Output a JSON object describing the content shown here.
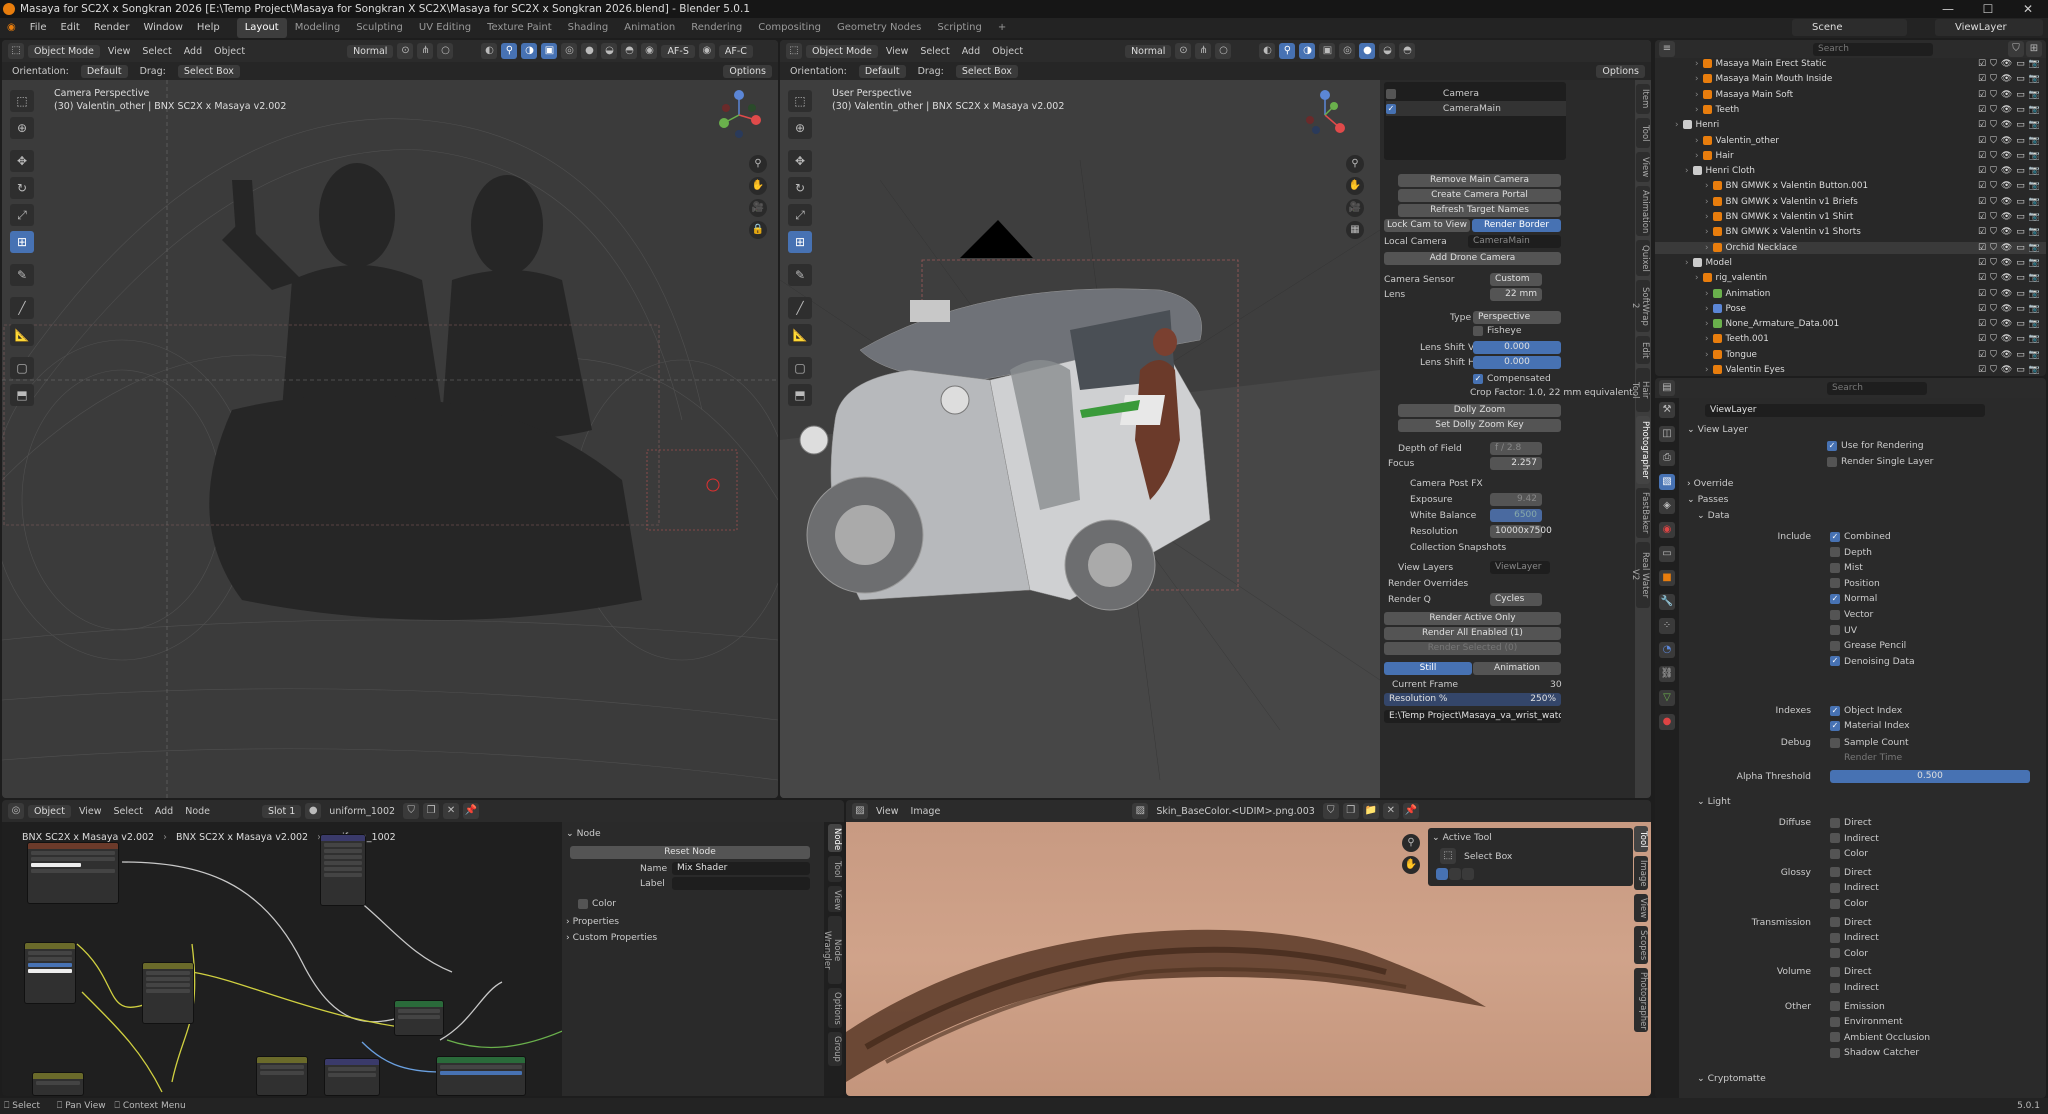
{
  "window": {
    "title": "Masaya for SC2X x Songkran 2026 [E:\\Temp Project\\Masaya for Songkran X SC2X\\Masaya for SC2X x Songkran 2026.blend] - Blender 5.0.1",
    "min": "—",
    "max": "☐",
    "close": "✕"
  },
  "menu": [
    "File",
    "Edit",
    "Render",
    "Window",
    "Help"
  ],
  "workspaces": [
    "Layout",
    "Modeling",
    "Sculpting",
    "UV Editing",
    "Texture Paint",
    "Shading",
    "Animation",
    "Rendering",
    "Compositing",
    "Geometry Nodes",
    "Scripting",
    "+"
  ],
  "scene": "Scene",
  "view_layer": "ViewLayer",
  "left_viewport": {
    "mode": "Object Mode",
    "menus": [
      "View",
      "Select",
      "Add",
      "Object"
    ],
    "shading": "Normal",
    "af_s": "AF-S",
    "af_c": "AF-C",
    "orientation_label": "Orientation:",
    "orientation": "Default",
    "drag_label": "Drag:",
    "drag": "Select Box",
    "options": "Options",
    "view_name": "Camera Perspective",
    "object_info": "(30) Valentin_other | BNX SC2X x Masaya v2.002"
  },
  "right_viewport": {
    "mode": "Object Mode",
    "menus": [
      "View",
      "Select",
      "Add",
      "Object"
    ],
    "shading": "Normal",
    "orientation_label": "Orientation:",
    "orientation": "Default",
    "drag_label": "Drag:",
    "drag": "Select Box",
    "options": "Options",
    "view_name": "User Perspective",
    "object_info": "(30) Valentin_other | BNX SC2X x Masaya v2.002"
  },
  "photographer": {
    "cameras": [
      "Camera",
      "CameraMain"
    ],
    "remove_main_camera": "Remove Main Camera",
    "create_camera_portal": "Create Camera Portal",
    "refresh_target_names": "Refresh Target Names",
    "lock_cam_to_view": "Lock Cam to View",
    "render_border": "Render Border",
    "local_camera_label": "Local Camera",
    "local_camera_value": "CameraMain",
    "add_drone_camera": "Add Drone Camera",
    "camera_sensor_label": "Camera Sensor",
    "camera_sensor_value": "Custom",
    "lens_label": "Lens",
    "lens_value": "22 mm",
    "type_label": "Type",
    "type_value": "Perspective",
    "fisheye": "Fisheye",
    "lens_shift_v_label": "Lens Shift V",
    "lens_shift_v": "0.000",
    "lens_shift_h_label": "Lens Shift H",
    "lens_shift_h": "0.000",
    "compensated": "Compensated",
    "crop_factor": "Crop Factor: 1.0, 22 mm equivalent.",
    "dolly_zoom": "Dolly Zoom",
    "set_dolly_zoom_key": "Set Dolly Zoom Key",
    "depth_of_field_label": "Depth of Field",
    "depth_of_field_value": "f / 2.8",
    "focus_label": "Focus",
    "focus_value": "2.257",
    "camera_post_fx": "Camera Post FX",
    "exposure_label": "Exposure",
    "exposure_value": "9.42",
    "white_balance_label": "White Balance",
    "white_balance_value": "6500",
    "resolution_label": "Resolution",
    "resolution_value": "10000x7500",
    "collection_snapshots": "Collection Snapshots",
    "view_layers_label": "View Layers",
    "view_layers_value": "ViewLayer",
    "render_overrides": "Render Overrides",
    "render_q_label": "Render Q",
    "render_q_engine": "Cycles",
    "render_active_only": "Render Active Only",
    "render_all_enabled": "Render All Enabled (1)",
    "render_selected": "Render Selected (0)",
    "still": "Still",
    "animation": "Animation",
    "current_frame_label": "Current Frame",
    "current_frame_value": "30",
    "resolution_pct_label": "Resolution %",
    "resolution_pct_value": "250%",
    "output_path": "E:\\Temp Project\\Masaya_va_wrist_watch_shadow"
  },
  "n_tabs_right": [
    "Item",
    "Tool",
    "View",
    "Animation",
    "Quixel",
    "SoftWrap 2",
    "Edit",
    "Hair Tool",
    "Photographer",
    "FastBaker",
    "Real Water V2"
  ],
  "outliner": {
    "search_placeholder": "Search",
    "items": [
      {
        "label": "Masaya Main Erect Static",
        "indent": 4
      },
      {
        "label": "Masaya Main Mouth Inside",
        "indent": 4
      },
      {
        "label": "Masaya Main Soft",
        "indent": 4
      },
      {
        "label": "Teeth",
        "indent": 4
      },
      {
        "label": "Henri",
        "indent": 2
      },
      {
        "label": "Valentin_other",
        "indent": 4
      },
      {
        "label": "Hair",
        "indent": 4
      },
      {
        "label": "Henri Cloth",
        "indent": 3
      },
      {
        "label": "BN GMWK x Valentin Button.001",
        "indent": 5
      },
      {
        "label": "BN GMWK x Valentin v1 Briefs",
        "indent": 5
      },
      {
        "label": "BN GMWK x Valentin v1 Shirt",
        "indent": 5
      },
      {
        "label": "BN GMWK x Valentin v1 Shorts",
        "indent": 5
      },
      {
        "label": "Orchid Necklace",
        "indent": 5
      },
      {
        "label": "Model",
        "indent": 3
      },
      {
        "label": "rig_valentin",
        "indent": 4
      },
      {
        "label": "Animation",
        "indent": 5
      },
      {
        "label": "Pose",
        "indent": 5
      },
      {
        "label": "None_Armature_Data.001",
        "indent": 5
      },
      {
        "label": "Teeth.001",
        "indent": 5
      },
      {
        "label": "Tongue",
        "indent": 5
      },
      {
        "label": "Valentin Eyes",
        "indent": 5
      }
    ],
    "badges": {
      "valentin_other": "2",
      "armature": "16"
    }
  },
  "properties": {
    "search_placeholder": "Search",
    "view_layer_name": "ViewLayer",
    "view_layer_panel": "View Layer",
    "use_for_rendering": "Use for Rendering",
    "render_single_layer": "Render Single Layer",
    "override": "Override",
    "passes": "Passes",
    "data": "Data",
    "include_label": "Include",
    "include": [
      {
        "label": "Combined",
        "on": true
      },
      {
        "label": "Depth",
        "on": false
      },
      {
        "label": "Mist",
        "on": false
      },
      {
        "label": "Position",
        "on": false
      },
      {
        "label": "Normal",
        "on": true
      },
      {
        "label": "Vector",
        "on": false
      },
      {
        "label": "UV",
        "on": false
      },
      {
        "label": "Grease Pencil",
        "on": false
      },
      {
        "label": "Denoising Data",
        "on": true
      }
    ],
    "indexes_label": "Indexes",
    "object_index": "Object Index",
    "material_index": "Material Index",
    "debug_label": "Debug",
    "sample_count": "Sample Count",
    "render_time": "Render Time",
    "alpha_threshold_label": "Alpha Threshold",
    "alpha_threshold_value": "0.500",
    "light": "Light",
    "diffuse_label": "Diffuse",
    "glossy_label": "Glossy",
    "transmission_label": "Transmission",
    "volume_label": "Volume",
    "other_label": "Other",
    "direct": "Direct",
    "indirect": "Indirect",
    "color": "Color",
    "emission": "Emission",
    "environment": "Environment",
    "ambient_occlusion": "Ambient Occlusion",
    "shadow_catcher": "Shadow Catcher",
    "cryptomatte": "Cryptomatte"
  },
  "node_editor": {
    "mode": "Object",
    "menus": [
      "View",
      "Select",
      "Add",
      "Node"
    ],
    "slot": "Slot 1",
    "material": "uniform_1002",
    "breadcrumb_obj": "BNX SC2X x Masaya v2.002",
    "breadcrumb_mesh": "BNX SC2X x Masaya v2.002",
    "breadcrumb_mat": "uniform_1002",
    "panel_title": "Node",
    "reset_node": "Reset Node",
    "name_label": "Name",
    "name_value": "Mix Shader",
    "label_label": "Label",
    "color": "Color",
    "properties": "Properties",
    "custom_properties": "Custom Properties",
    "tabs": [
      "Node",
      "Tool",
      "View",
      "Node Wrangler",
      "Options",
      "Group"
    ]
  },
  "image_editor": {
    "menus": [
      "View",
      "Image"
    ],
    "image_name": "Skin_BaseColor.<UDIM>.png.003",
    "active_tool": "Active Tool",
    "select_box": "Select Box",
    "tabs": [
      "Tool",
      "Image",
      "View",
      "Scopes",
      "Photographer"
    ]
  },
  "statusbar": {
    "select": "Select",
    "pan_view": "Pan View",
    "context_menu": "Context Menu",
    "version": "5.0.1"
  },
  "colors": {
    "accent": "#4772b3",
    "header": "#2b2b2b",
    "panel": "#2a2a2a",
    "blender_orange": "#e87d0d"
  }
}
